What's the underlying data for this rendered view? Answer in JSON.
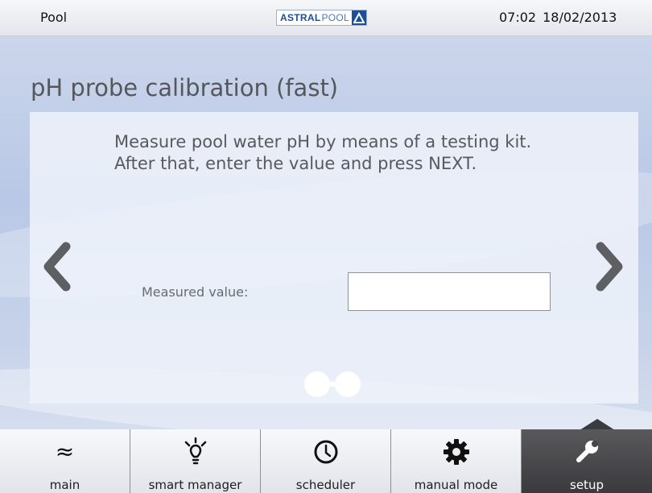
{
  "status_bar": {
    "title": "Pool",
    "logo_text_bold": "ASTRAL",
    "logo_text_light": "POOL",
    "time": "07:02",
    "date": "18/02/2013"
  },
  "screen": {
    "title": "pH probe calibration (fast)",
    "instructions": "Measure pool water pH by means of a testing kit. After that, enter the value and press NEXT.",
    "measured_label": "Measured value:",
    "measured_value": "",
    "prev_icon": "chevron-left-icon",
    "next_icon": "chevron-right-icon",
    "step_current": 1,
    "step_total": 2
  },
  "bottom_nav": {
    "tabs": [
      {
        "label": "main",
        "icon": "waves-icon"
      },
      {
        "label": "smart manager",
        "icon": "lightbulb-icon"
      },
      {
        "label": "scheduler",
        "icon": "clock-icon"
      },
      {
        "label": "manual mode",
        "icon": "gear-icon"
      },
      {
        "label": "setup",
        "icon": "wrench-icon",
        "active": true
      }
    ]
  },
  "colors": {
    "active_tab": "#3a3a3d",
    "brand_blue": "#1d4e9a",
    "text_gray": "#58595d"
  }
}
